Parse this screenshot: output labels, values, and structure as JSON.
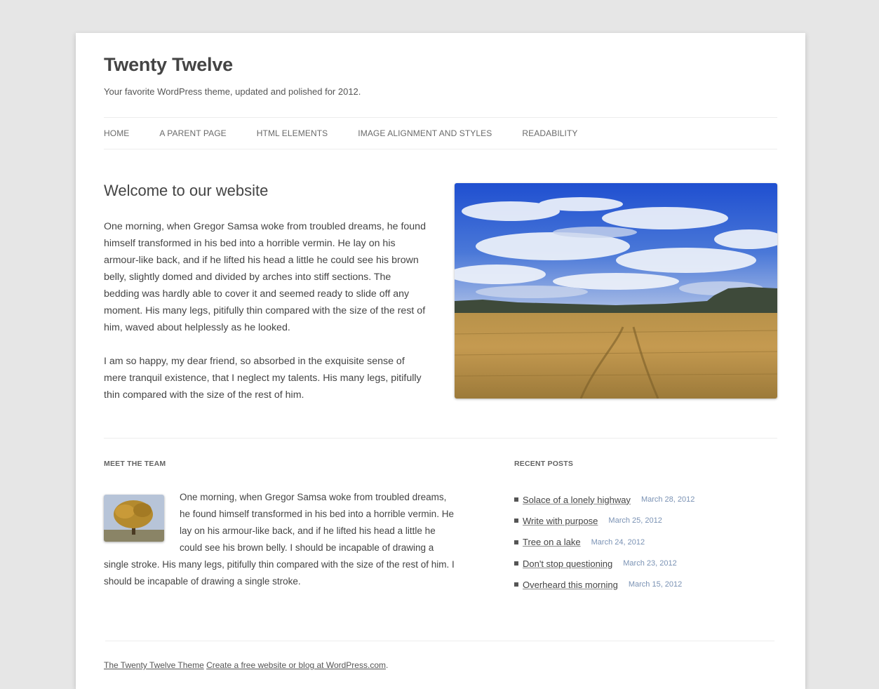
{
  "site": {
    "title": "Twenty Twelve",
    "description": "Your favorite WordPress theme, updated and polished for 2012."
  },
  "nav": {
    "items": [
      "HOME",
      "A PARENT PAGE",
      "HTML ELEMENTS",
      "IMAGE ALIGNMENT AND STYLES",
      "READABILITY"
    ]
  },
  "welcome": {
    "title": "Welcome to our website",
    "paragraph1": "One morning, when Gregor Samsa woke from troubled dreams, he found himself transformed in his bed into a horrible vermin. He lay on his armour-like back, and if he lifted his head a little he could see his brown belly, slightly domed and divided by arches into stiff sections. The bedding was hardly able to cover it and seemed ready to slide off any moment. His many legs, pitifully thin compared with the size of the rest of him, waved about helplessly as he looked.",
    "paragraph2": "I am so happy, my dear friend, so absorbed in the exquisite sense of mere tranquil existence, that I neglect my talents. His many legs, piti­fully thin compared with the size of the rest of him."
  },
  "team": {
    "heading": "MEET THE TEAM",
    "text": "One morning, when Gregor Samsa woke from troubled dreams, he found himself transformed in his bed into a horrible vermin. He lay on his armour-like back, and if he lifted his head a little he could see his brown belly. I should be incapable of drawing a single stroke. His many legs, pitifully thin compared with the size of the rest of him. I should be incapable of drawing a single stroke."
  },
  "recent_posts": {
    "heading": "RECENT POSTS",
    "items": [
      {
        "title": "Solace of a lonely highway",
        "date": "March 28, 2012"
      },
      {
        "title": "Write with purpose",
        "date": "March 25, 2012"
      },
      {
        "title": "Tree on a lake",
        "date": "March 24, 2012"
      },
      {
        "title": "Don't stop questioning",
        "date": "March 23, 2012"
      },
      {
        "title": "Overheard this morning",
        "date": "March 15, 2012"
      }
    ]
  },
  "footer": {
    "theme_link": "The Twenty Twelve Theme",
    "wp_link": "Create a free website or blog at WordPress.com",
    "suffix": "."
  },
  "colors": {
    "background": "#e6e6e6",
    "page": "#ffffff",
    "text": "#444444",
    "date": "#7a92b4"
  }
}
